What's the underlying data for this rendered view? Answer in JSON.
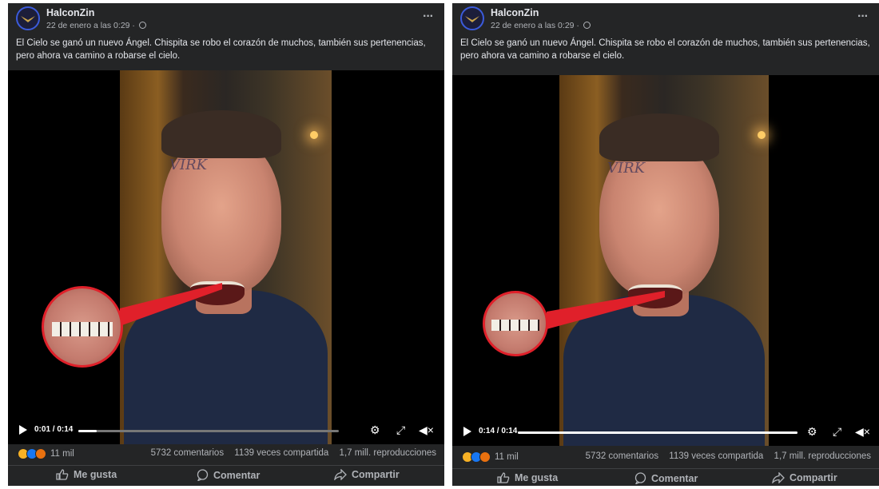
{
  "posts": [
    {
      "author": "HalconZin",
      "date": "22 de enero a las 0:29",
      "date_separator": "·",
      "more": "···",
      "caption": "El Cielo se ganó un nuevo Ángel. Chispita se robo el corazón de muchos, también sus pertenencias, pero ahora va camino a robarse el cielo.",
      "video": {
        "time": "0:01 / 0:14",
        "progress": 0.07
      },
      "reactions_count": "11 mil",
      "comments": "5732 comentarios",
      "shares": "1139 veces compartida",
      "views": "1,7 mill. reproducciones",
      "actions": {
        "like": "Me gusta",
        "comment": "Comentar",
        "share": "Compartir"
      }
    },
    {
      "author": "HalconZin",
      "date": "22 de enero a las 0:29",
      "date_separator": "·",
      "more": "···",
      "caption": "El Cielo se ganó un nuevo Ángel. Chispita se robo el corazón de muchos, también sus pertenencias, pero ahora va camino a robarse el cielo.",
      "video": {
        "time": "0:14 / 0:14",
        "progress": 1.0
      },
      "reactions_count": "11 mil",
      "comments": "5732 comentarios",
      "shares": "1139 veces compartida",
      "views": "1,7 mill. reproducciones",
      "actions": {
        "like": "Me gusta",
        "comment": "Comentar",
        "share": "Compartir"
      }
    }
  ],
  "colors": {
    "post_bg": "#242526",
    "text_primary": "#e4e6eb",
    "text_secondary": "#b0b3b8",
    "highlight_red": "#e0202a",
    "like_blue": "#1877f2",
    "haha_yellow": "#f7b125",
    "angry_orange": "#e9710f"
  },
  "icons": [
    "avatar-falcon-icon",
    "globe-icon",
    "more-icon",
    "play-icon",
    "settings-icon",
    "fullscreen-icon",
    "mute-icon",
    "like-icon",
    "comment-icon",
    "share-icon"
  ]
}
